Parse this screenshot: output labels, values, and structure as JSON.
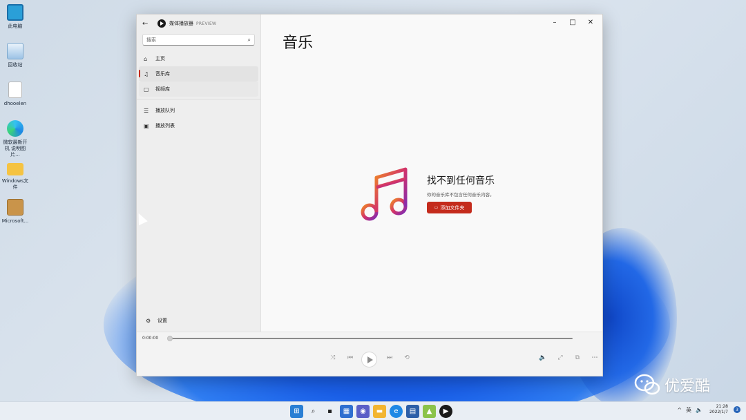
{
  "desktop": {
    "icons": [
      {
        "label": "此电脑",
        "icon": "computer-icon",
        "color": "#2a9fd8"
      },
      {
        "label": "回收站",
        "icon": "recycle-bin-icon",
        "color": "#6aa8d8"
      },
      {
        "label": "dhooelen",
        "icon": "file-icon",
        "color": "#ffffff"
      },
      {
        "label": "微软最新开机 说明图片...",
        "icon": "edge-icon",
        "color": "#1e88e5"
      },
      {
        "label": "Windows文件",
        "icon": "folder-icon",
        "color": "#f5c342"
      },
      {
        "label": "Microsoft...",
        "icon": "package-icon",
        "color": "#c9944a"
      }
    ]
  },
  "window": {
    "app_title": "媒体播放器",
    "preview_tag": "PREVIEW",
    "search_placeholder": "搜索",
    "nav": [
      {
        "label": "主页",
        "icon": "home-icon"
      },
      {
        "label": "音乐库",
        "icon": "music-note-icon",
        "selected": true
      },
      {
        "label": "视频库",
        "icon": "video-icon"
      },
      {
        "label": "播放队列",
        "icon": "queue-icon"
      },
      {
        "label": "播放列表",
        "icon": "playlist-icon"
      }
    ],
    "settings_label": "设置",
    "page_title": "音乐",
    "empty": {
      "heading": "找不到任何音乐",
      "subtext": "你的音乐库不包含任何音乐内容。",
      "button": "添加文件夹"
    },
    "player": {
      "time": "0:00:00",
      "progress": 0
    },
    "accent": "#c42b1c"
  },
  "watermark": "优爱酷",
  "taskbar": {
    "lang": "英",
    "time": "21:28",
    "date": "2022/1/7",
    "notification_count": "3"
  }
}
